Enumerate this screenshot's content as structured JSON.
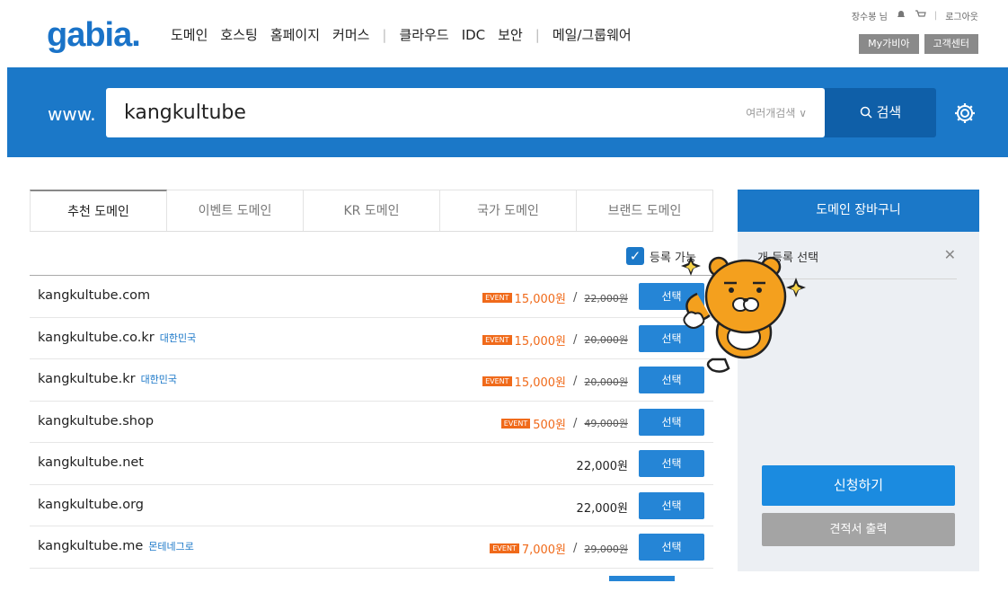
{
  "header": {
    "logo": "gabia.",
    "nav": [
      "도메인",
      "호스팅",
      "홈페이지",
      "커머스",
      "클라우드",
      "IDC",
      "보안",
      "메일/그룹웨어"
    ],
    "util": {
      "user": "장수봉 님",
      "logout": "로그아웃"
    },
    "my_gabia": "My가비아",
    "customer_center": "고객센터"
  },
  "search": {
    "prefix": "www.",
    "query": "kangkultube",
    "multi_search": "여러개검색 ∨",
    "button": "검색"
  },
  "tabs": [
    "추천 도메인",
    "이벤트 도메인",
    "KR 도메인",
    "국가 도메인",
    "브랜드 도메인"
  ],
  "filter_label": "등록 가능",
  "domains": [
    {
      "name": "kangkultube.com",
      "country": "",
      "event": "EVENT",
      "price": "15,000원",
      "old": "22,000원",
      "btn": "선택"
    },
    {
      "name": "kangkultube.co.kr",
      "country": "대한민국",
      "event": "EVENT",
      "price": "15,000원",
      "old": "20,000원",
      "btn": "선택"
    },
    {
      "name": "kangkultube.kr",
      "country": "대한민국",
      "event": "EVENT",
      "price": "15,000원",
      "old": "20,000원",
      "btn": "선택"
    },
    {
      "name": "kangkultube.shop",
      "country": "",
      "event": "EVENT",
      "price": "500원",
      "old": "49,000원",
      "btn": "선택"
    },
    {
      "name": "kangkultube.net",
      "country": "",
      "event": "",
      "price": "22,000원",
      "old": "",
      "btn": "선택"
    },
    {
      "name": "kangkultube.org",
      "country": "",
      "event": "",
      "price": "22,000원",
      "old": "",
      "btn": "선택"
    },
    {
      "name": "kangkultube.me",
      "country": "몬테네그로",
      "event": "EVENT",
      "price": "7,000원",
      "old": "29,000원",
      "btn": "선택"
    }
  ],
  "cart": {
    "title": "도메인 장바구니",
    "count_text": "개 등록 선택",
    "close": "✕",
    "apply": "신청하기",
    "quote": "견적서 출력"
  },
  "colors": {
    "brand": "#1b78c8",
    "event": "#f06a1a"
  }
}
